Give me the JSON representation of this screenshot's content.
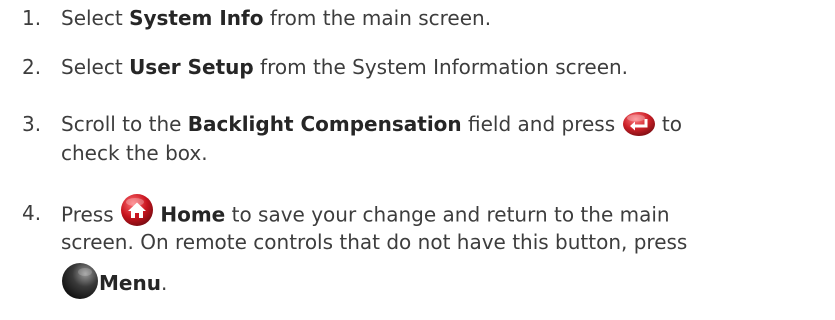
{
  "steps": [
    {
      "number": "1.",
      "before": "Select ",
      "bold": "System Info",
      "after": " from the main screen."
    },
    {
      "number": "2.",
      "before": "Select ",
      "bold": "User Setup",
      "after": " from the System Information screen."
    },
    {
      "number": "3.",
      "before": "Scroll to the ",
      "bold": "Backlight Compensation",
      "middle": " field and press ",
      "end": " to",
      "line2": "check the box.",
      "icon": "enter-button-icon"
    },
    {
      "number": "4.",
      "before": "Press ",
      "bold": "Home",
      "after": " to save your change and return to the main",
      "line2": "screen. On remote controls that do not have this button, press",
      "bold2": "Menu",
      "end": ".",
      "icon": "home-button-icon",
      "icon2": "menu-button-icon"
    }
  ],
  "colors": {
    "text": "#3d3d3d",
    "enter_button": "#cc2028",
    "home_button": "#c8141e",
    "menu_button": "#333333"
  }
}
